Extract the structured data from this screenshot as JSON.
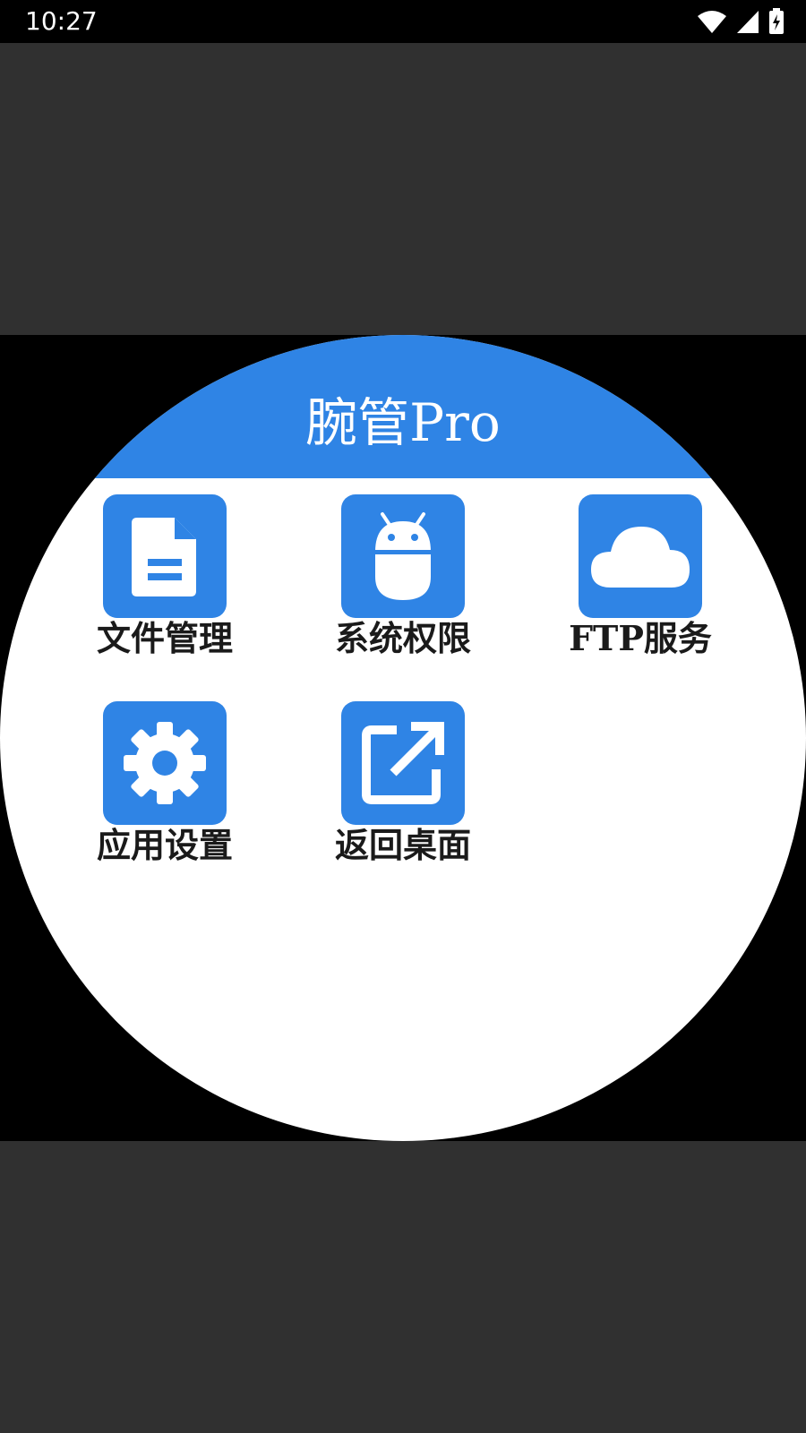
{
  "status_bar": {
    "time": "10:27",
    "icons": [
      "wifi-icon",
      "signal-icon",
      "battery-charging-icon"
    ]
  },
  "app": {
    "title": "腕管Pro",
    "accent_color": "#2f84e5"
  },
  "menu": [
    {
      "label": "文件管理",
      "icon": "document-icon"
    },
    {
      "label": "系统权限",
      "icon": "android-icon"
    },
    {
      "label": "FTP服务",
      "icon": "cloud-icon"
    },
    {
      "label": "应用设置",
      "icon": "gear-icon"
    },
    {
      "label": "返回桌面",
      "icon": "external-link-icon"
    }
  ]
}
